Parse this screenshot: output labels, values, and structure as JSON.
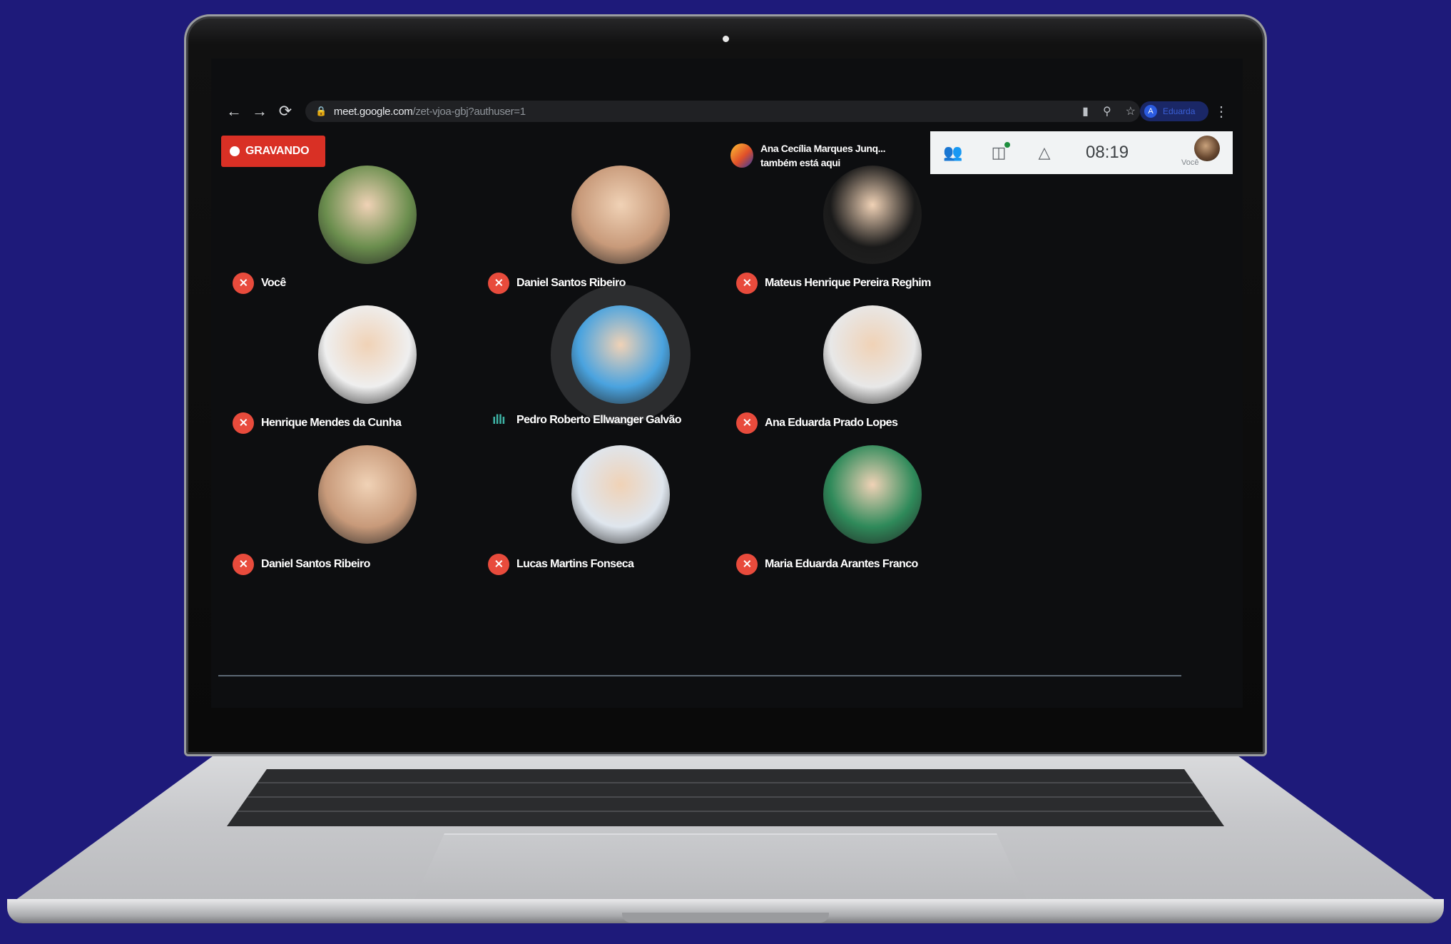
{
  "browser": {
    "back_icon": "←",
    "forward_icon": "→",
    "reload_icon": "⟳",
    "lock_icon": "🔒",
    "url_domain": "meet.google.com",
    "url_path": "/zet-vjoa-gbj?authuser=1",
    "profile_initial": "A",
    "profile_name": "Eduarda",
    "menu_icon": "⋮"
  },
  "meeting": {
    "recording_label": "GRAVANDO",
    "notice_line1": "Ana Cecília Marques Junq...",
    "notice_line2": "também está aqui",
    "time": "08:19",
    "self_label": "Você",
    "participants_icon": "people-icon",
    "chat_icon": "chat-icon",
    "activities_icon": "activities-icon"
  },
  "participants": [
    {
      "name": "Você",
      "state": "muted",
      "avatar_color": "#6b8e4e"
    },
    {
      "name": "Daniel Santos Ribeiro",
      "state": "muted",
      "avatar_color": "#c89a7a"
    },
    {
      "name": "Mateus Henrique Pereira Reghim",
      "state": "muted",
      "avatar_color": "#1a1a1a"
    },
    {
      "name": "Henrique Mendes da Cunha",
      "state": "muted",
      "avatar_color": "#efefef"
    },
    {
      "name": "Pedro Roberto Ellwanger Galvão",
      "state": "speaking",
      "avatar_color": "#4aa3df"
    },
    {
      "name": "Ana Eduarda Prado Lopes",
      "state": "muted",
      "avatar_color": "#e8e8e8"
    },
    {
      "name": "Daniel Santos Ribeiro",
      "state": "muted",
      "avatar_color": "#c89a7a"
    },
    {
      "name": "Lucas Martins Fonseca",
      "state": "muted",
      "avatar_color": "#dfe6ee"
    },
    {
      "name": "Maria Eduarda Arantes Franco",
      "state": "muted",
      "avatar_color": "#2f8a5a"
    }
  ]
}
